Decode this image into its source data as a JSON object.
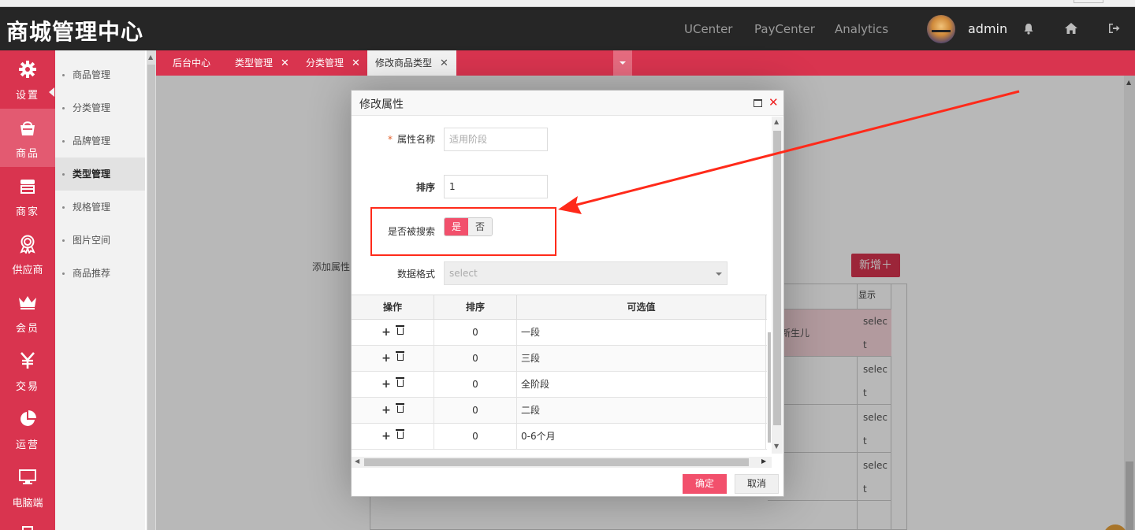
{
  "header": {
    "logo": "商城管理中心",
    "nav": [
      "UCenter",
      "PayCenter",
      "Analytics"
    ],
    "username": "admin"
  },
  "sidebar": {
    "items": [
      {
        "label": "设置",
        "icon": "gear-icon"
      },
      {
        "label": "商品",
        "icon": "shopping-bag-icon"
      },
      {
        "label": "商家",
        "icon": "store-icon"
      },
      {
        "label": "供应商",
        "icon": "award-icon"
      },
      {
        "label": "会员",
        "icon": "crown-icon"
      },
      {
        "label": "交易",
        "icon": "yen-icon"
      },
      {
        "label": "运营",
        "icon": "pie-chart-icon"
      },
      {
        "label": "电脑端",
        "icon": "monitor-icon"
      }
    ],
    "active_index": 1
  },
  "submenu": {
    "items": [
      "商品管理",
      "分类管理",
      "品牌管理",
      "类型管理",
      "规格管理",
      "图片空间",
      "商品推荐"
    ],
    "active_index": 3
  },
  "tabs": [
    {
      "label": "后台中心",
      "closable": false
    },
    {
      "label": "类型管理",
      "closable": true
    },
    {
      "label": "分类管理",
      "closable": true
    },
    {
      "label": "修改商品类型",
      "closable": true,
      "active": true
    }
  ],
  "background": {
    "add_attr_label": "添加属性",
    "new_button": "新增＋",
    "table_header_show": "显示",
    "row_text": "新生儿",
    "cell_select": [
      "selec",
      "t"
    ]
  },
  "dialog": {
    "title": "修改属性",
    "attr_name_label": "属性名称",
    "attr_name_placeholder": "适用阶段",
    "sort_label": "排序",
    "sort_value": "1",
    "searchable_label": "是否被搜索",
    "toggle_on": "是",
    "toggle_off": "否",
    "data_format_label": "数据格式",
    "data_format_value": "select",
    "table": {
      "headers": [
        "操作",
        "排序",
        "可选值"
      ],
      "rows": [
        {
          "sort": "0",
          "value": "一段"
        },
        {
          "sort": "0",
          "value": "三段"
        },
        {
          "sort": "0",
          "value": "全阶段"
        },
        {
          "sort": "0",
          "value": "二段"
        },
        {
          "sort": "0",
          "value": "0-6个月"
        }
      ]
    },
    "ok_button": "确定",
    "cancel_button": "取消"
  },
  "colors": {
    "brand_red": "#d9344f",
    "header_dark": "#262626",
    "annotation_red": "#ff2a1a"
  }
}
